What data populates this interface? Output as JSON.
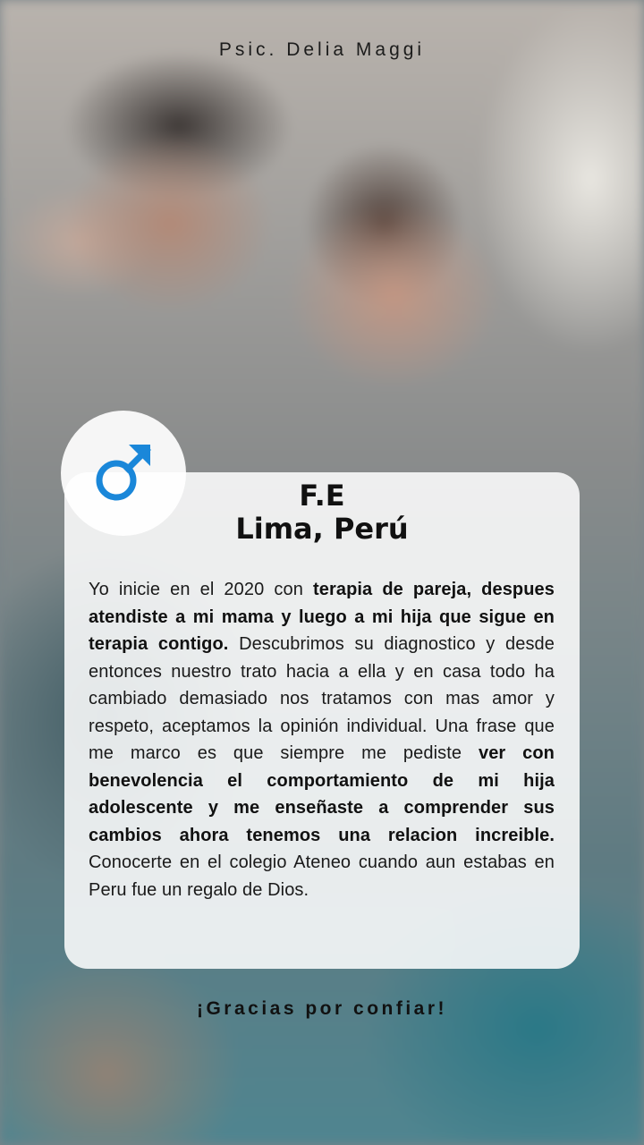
{
  "header": {
    "author": "Psic. Delia Maggi"
  },
  "icon": {
    "name": "male-symbol-icon",
    "color": "#1a87d9"
  },
  "card": {
    "name_line": "F.E",
    "location_line": "Lima, Perú",
    "testimonial_segments": [
      {
        "text": "Yo inicie en el 2020 con ",
        "bold": false
      },
      {
        "text": "terapia de pareja, despues atendiste a mi mama y luego a mi hija que sigue en terapia contigo.",
        "bold": true
      },
      {
        "text": " Descubrimos su diagnostico y desde entonces nuestro trato hacia a ella y en casa todo ha cambiado demasiado nos tratamos con mas amor y respeto, aceptamos la opinión individual. Una frase que me marco es que siempre me pediste ",
        "bold": false
      },
      {
        "text": "ver con benevolencia el comportamiento de mi hija adolescente y me enseñaste a comprender sus cambios ahora tenemos una relacion increible.",
        "bold": true
      },
      {
        "text": " Conocerte en el colegio Ateneo cuando aun estabas en Peru fue un regalo de Dios.",
        "bold": false
      }
    ]
  },
  "footer": {
    "thanks": "¡Gracias por confiar!"
  }
}
